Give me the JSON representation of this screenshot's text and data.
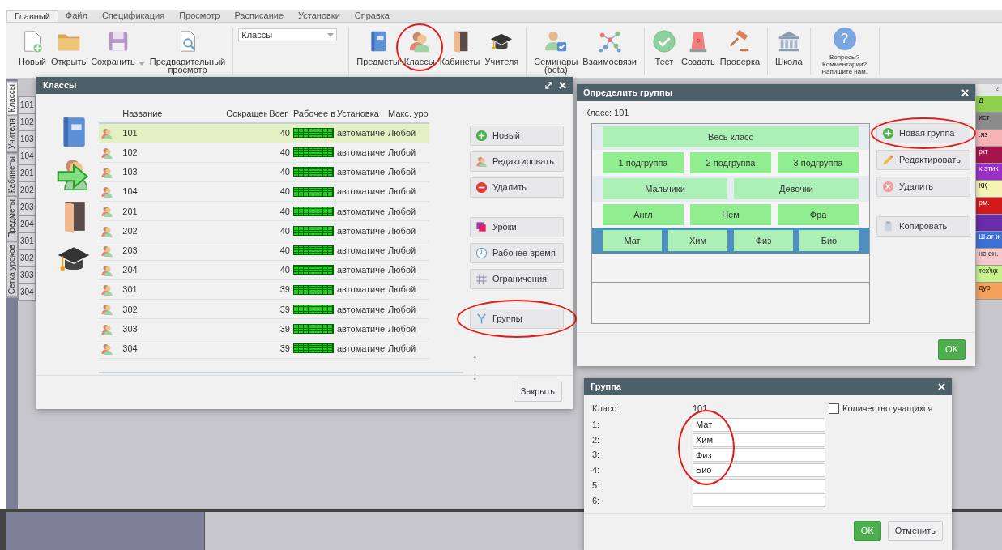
{
  "menu_tabs": [
    {
      "label": "Главный",
      "selected": true
    },
    {
      "label": "Файл",
      "selected": false
    },
    {
      "label": "Спецификация",
      "selected": false
    },
    {
      "label": "Просмотр",
      "selected": false
    },
    {
      "label": "Расписание",
      "selected": false
    },
    {
      "label": "Установки",
      "selected": false
    },
    {
      "label": "Справка",
      "selected": false
    }
  ],
  "toolbar": {
    "groups": [
      {
        "kind": "tools",
        "items": [
          {
            "label": "Новый"
          },
          {
            "label": "Открыть"
          },
          {
            "label": "Сохранить",
            "dropdown": true
          },
          {
            "label": "Предварительный просмотр"
          }
        ]
      },
      {
        "kind": "select",
        "value": "Классы"
      },
      {
        "kind": "tools",
        "items": [
          {
            "label": "Предметы"
          },
          {
            "label": "Классы",
            "circled": true
          },
          {
            "label": "Кабинеты"
          },
          {
            "label": "Учителя"
          }
        ]
      },
      {
        "kind": "tools",
        "items": [
          {
            "label": "Семинары (beta)"
          },
          {
            "label": "Взаимосвязи"
          }
        ]
      },
      {
        "kind": "tools",
        "items": [
          {
            "label": "Тест"
          },
          {
            "label": "Создать"
          },
          {
            "label": "Проверка"
          }
        ]
      },
      {
        "kind": "tools",
        "items": [
          {
            "label": "Школа"
          }
        ]
      },
      {
        "kind": "help",
        "glyph": "?",
        "text": "Вопросы? Комментарии? Напишите нам."
      }
    ]
  },
  "side_tabs": [
    {
      "label": "Классы",
      "selected": true
    },
    {
      "label": "Учителя",
      "selected": false
    },
    {
      "label": "Кабинеты",
      "selected": false
    },
    {
      "label": "Предметы",
      "selected": false
    },
    {
      "label": "Сетка уроков",
      "selected": false
    }
  ],
  "class_rows": [
    "101",
    "102",
    "103",
    "104",
    "201",
    "202",
    "203",
    "204",
    "301",
    "302",
    "303",
    "304"
  ],
  "timetable": {
    "header": "2",
    "cells": [
      {
        "text": "Д",
        "color": "#8fd14f"
      },
      {
        "text": "ист",
        "color": "#8c8c8c"
      },
      {
        "text": ".яз",
        "color": "#f5b5b5"
      },
      {
        "text": "р\\т",
        "color": "#a3154b"
      },
      {
        "text": "х.этик",
        "color": "#9b30c8"
      },
      {
        "text": "КҚ",
        "color": "#f6f3b4"
      },
      {
        "text": "рм.",
        "color": "#d11a1a"
      },
      {
        "color": "#6a2ca8"
      },
      {
        "text": "Ш.аг ж",
        "color": "#3d6fd4"
      },
      {
        "text": "нс.ен.",
        "color": "#f4c8cc"
      },
      {
        "text": "тех\\қк",
        "color": "#c9f28f"
      },
      {
        "text": "дур",
        "color": "#f6a05a"
      }
    ]
  },
  "classes_dialog": {
    "title": "Классы",
    "columns": [
      "Название",
      "Сокращен",
      "Всег",
      "Рабочее в",
      "Установка",
      "Макс. уро"
    ],
    "rows": [
      {
        "name": "101",
        "total": "40",
        "setting": "автоматиче",
        "max": "Любой",
        "selected": true
      },
      {
        "name": "102",
        "total": "40",
        "setting": "автоматиче",
        "max": "Любой",
        "selected": false
      },
      {
        "name": "103",
        "total": "40",
        "setting": "автоматиче",
        "max": "Любой",
        "selected": false
      },
      {
        "name": "104",
        "total": "40",
        "setting": "автоматиче",
        "max": "Любой",
        "selected": false
      },
      {
        "name": "201",
        "total": "40",
        "setting": "автоматиче",
        "max": "Любой",
        "selected": false
      },
      {
        "name": "202",
        "total": "40",
        "setting": "автоматиче",
        "max": "Любой",
        "selected": false
      },
      {
        "name": "203",
        "total": "40",
        "setting": "автоматиче",
        "max": "Любой",
        "selected": false
      },
      {
        "name": "204",
        "total": "40",
        "setting": "автоматиче",
        "max": "Любой",
        "selected": false
      },
      {
        "name": "301",
        "total": "39",
        "setting": "автоматиче",
        "max": "Любой",
        "selected": false
      },
      {
        "name": "302",
        "total": "39",
        "setting": "автоматиче",
        "max": "Любой",
        "selected": false
      },
      {
        "name": "303",
        "total": "39",
        "setting": "автоматиче",
        "max": "Любой",
        "selected": false
      },
      {
        "name": "304",
        "total": "39",
        "setting": "автоматиче",
        "max": "Любой",
        "selected": false
      }
    ],
    "button_groups": [
      [
        {
          "label": "Новый"
        },
        {
          "label": "Редактировать"
        },
        {
          "label": "Удалить"
        }
      ],
      [
        {
          "label": "Уроки"
        },
        {
          "label": "Рабочее время"
        },
        {
          "label": "Ограничения"
        }
      ],
      [
        {
          "label": "Группы",
          "circled": true
        }
      ]
    ],
    "move_arrows": [
      "↑",
      "↓"
    ],
    "close_button": "Закрыть"
  },
  "groups_dialog": {
    "title": "Определить группы",
    "class_label": "Класс: 101",
    "rows": [
      {
        "selected": false,
        "groups": [
          "Весь класс"
        ]
      },
      {
        "selected": false,
        "groups": [
          "1 подгруппа",
          "2 подгруппа",
          "3 подгруппа"
        ]
      },
      {
        "selected": false,
        "groups": [
          "Мальчики",
          "Девочки"
        ]
      },
      {
        "selected": false,
        "groups": [
          "Англ",
          "Нем",
          "Фра"
        ]
      },
      {
        "selected": true,
        "groups": [
          "Мат",
          "Хим",
          "Физ",
          "Био"
        ]
      }
    ],
    "buttons": [
      {
        "label": "Новая группа",
        "circled": true
      },
      {
        "label": "Редактировать"
      },
      {
        "label": "Удалить"
      },
      {
        "label": "Копировать",
        "gap_before": true
      }
    ],
    "ok_button": "OK"
  },
  "group_dialog": {
    "title": "Группа",
    "class_label": "Класс:",
    "class_value": "101",
    "count_checkbox": {
      "label": "Количество учащихся",
      "checked": false
    },
    "fields": [
      {
        "label": "1:",
        "value": "Мат",
        "circled": true
      },
      {
        "label": "2:",
        "value": "Хим",
        "circled": true
      },
      {
        "label": "3:",
        "value": "Физ",
        "circled": true
      },
      {
        "label": "4:",
        "value": "Био",
        "circled": true
      },
      {
        "label": "5:"
      },
      {
        "label": "6:"
      }
    ],
    "buttons": [
      {
        "label": "OK",
        "kind": "primary"
      },
      {
        "label": "Отменить",
        "kind": "secondary"
      }
    ]
  }
}
